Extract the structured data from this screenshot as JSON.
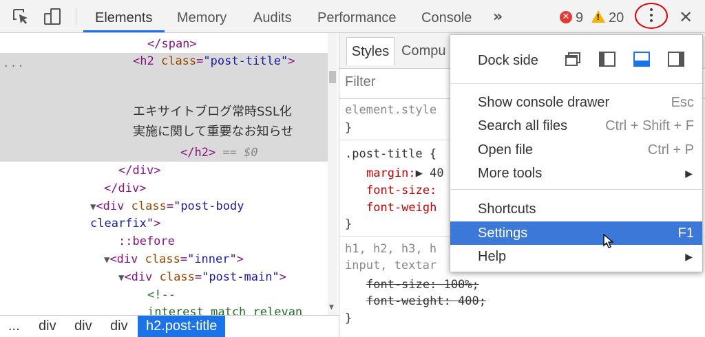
{
  "toolbar": {
    "tabs": [
      "Elements",
      "Memory",
      "Audits",
      "Performance",
      "Console"
    ],
    "more_tabs": "»",
    "error_count": "9",
    "warning_count": "20",
    "close": "✕"
  },
  "dom": {
    "lines": {
      "span_close": "</span>",
      "h2_open_tag": "<h2",
      "h2_attr": "class",
      "h2_val": "\"post-title\"",
      "h2_end": ">",
      "jp_line1": "エキサイトブログ常時SSL化",
      "jp_line2": "実施に関して重要なお知らせ",
      "h2_close": "</h2>",
      "eq_dollar": "== $0",
      "div_close1": "</div>",
      "div_close2": "</div>",
      "div_postbody_open": "<div",
      "div_postbody_attr": "class",
      "div_postbody_val": "\"post-body",
      "div_postbody_val2": "clearfix\"",
      "div_postbody_end": ">",
      "before": "::before",
      "div_inner_open": "<div",
      "div_inner_attr": "class",
      "div_inner_val": "\"inner\"",
      "div_inner_end": ">",
      "div_main_open": "<div",
      "div_main_attr": "class",
      "div_main_val": "\"post-main\"",
      "div_main_end": ">",
      "comment_open": "<!--",
      "comment_text": "interest_match_relevan"
    },
    "row_menu": "..."
  },
  "breadcrumb": {
    "items": [
      "...",
      "div",
      "div",
      "div",
      "h2.post-title"
    ]
  },
  "styles": {
    "tabs": [
      "Styles",
      "Compu"
    ],
    "filter_placeholder": "Filter",
    "element_style": "element.style",
    "brace_close": "}",
    "post_title_selector": ".post-title {",
    "margin_prop": "margin:",
    "margin_val": "▶ 40",
    "font_size_prop": "font-size:",
    "font_weight_prop": "font-weigh",
    "headings_selector_1": "h1, h2, h3, h",
    "headings_selector_2": "input, textar",
    "struck_font_size": "font-size: 100%;",
    "struck_font_weight": "font-weight: 400;"
  },
  "menu": {
    "dock_side_label": "Dock side",
    "items": [
      {
        "label": "Show console drawer",
        "shortcut": "Esc"
      },
      {
        "label": "Search all files",
        "shortcut": "Ctrl + Shift + F"
      },
      {
        "label": "Open file",
        "shortcut": "Ctrl + P"
      },
      {
        "label": "More tools",
        "shortcut": ""
      },
      {
        "label": "Shortcuts",
        "shortcut": ""
      },
      {
        "label": "Settings",
        "shortcut": "F1"
      },
      {
        "label": "Help",
        "shortcut": ""
      }
    ]
  },
  "colors": {
    "accent": "#1a73e8",
    "highlight": "#3b78d8",
    "error": "#e53935",
    "warning": "#f4b400",
    "annotation": "#e00000"
  }
}
